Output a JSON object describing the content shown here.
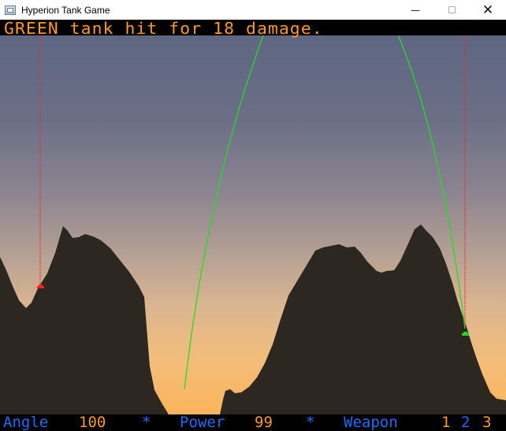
{
  "window": {
    "title": "Hyperion Tank Game",
    "minimize_glyph": "—",
    "close_glyph": "✕"
  },
  "hud": {
    "message": "GREEN tank hit for 18 damage.",
    "angle_label": "Angle",
    "angle_value": "100",
    "separator": "*",
    "power_label": "Power",
    "power_value": "99",
    "weapon_label": "Weapon",
    "weapon_options": [
      "1",
      "2",
      "3"
    ]
  },
  "colors": {
    "message_text": "#ff9a1a",
    "hud_label": "#1a6cff",
    "hud_value": "#ff9a1a",
    "terrain": "#2d2722",
    "trajectory": "#22dd22",
    "aim_line": "#ff2222",
    "tank_red": "#ff2222",
    "tank_green": "#22dd22"
  },
  "icons": {
    "app": "window-icon",
    "minimize": "minimize-icon",
    "maximize": "maximize-icon",
    "close": "close-icon"
  }
}
